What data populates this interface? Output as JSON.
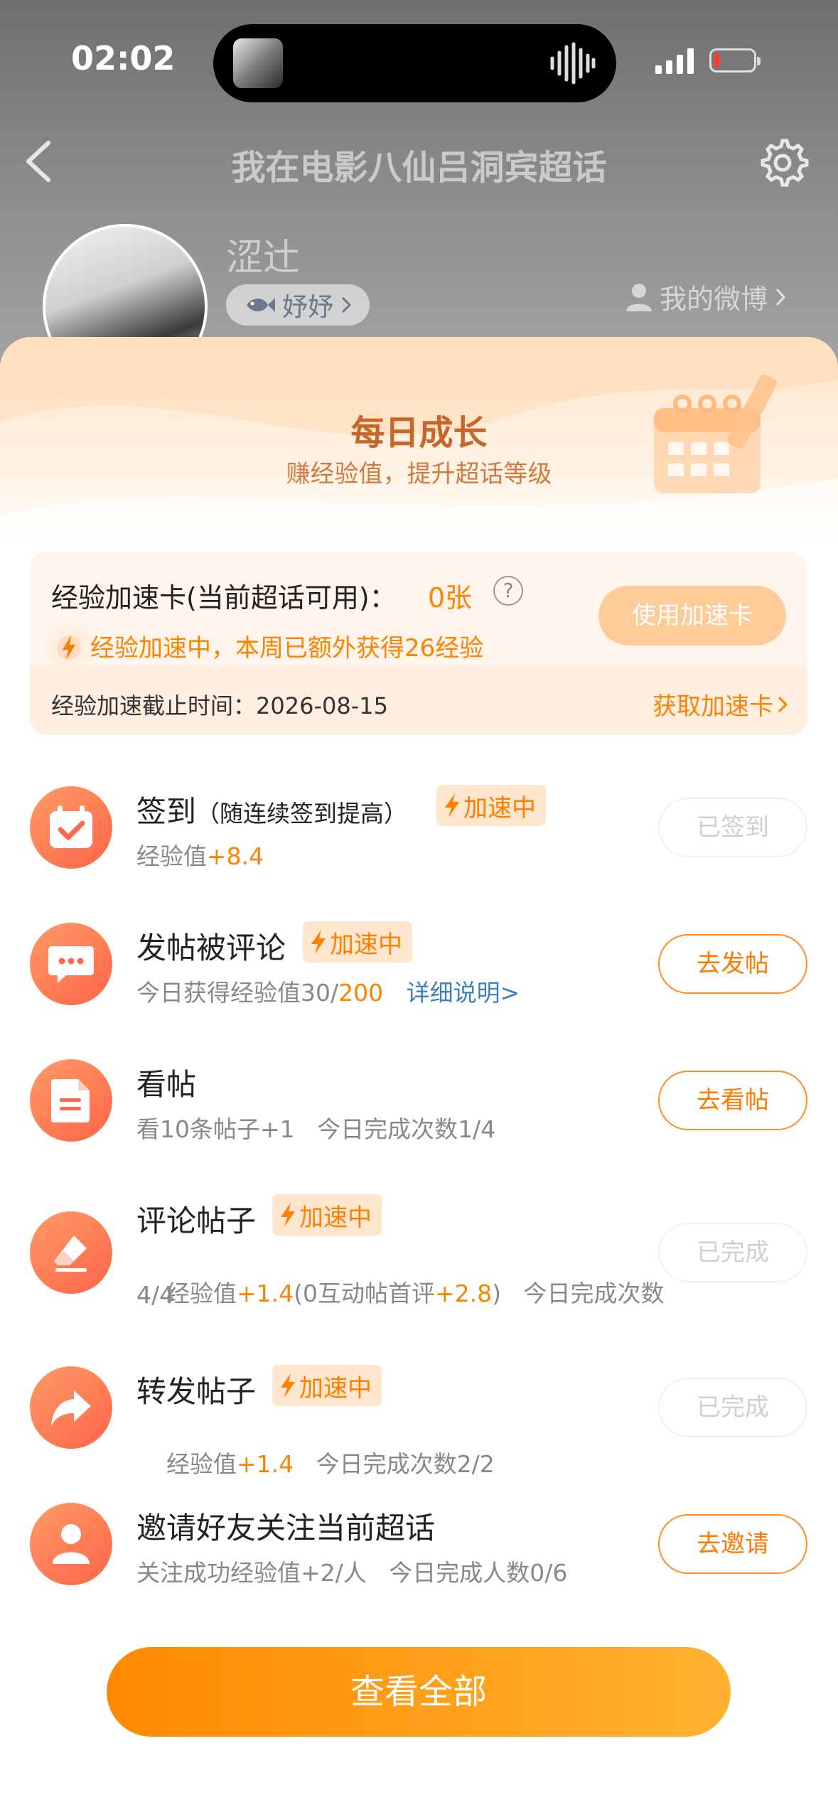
{
  "status_bar": {
    "time": "02:02"
  },
  "header": {
    "title": "我在电影八仙吕洞宾超话"
  },
  "profile": {
    "name": "涩辻",
    "level_label": "妤妤",
    "my_weibo": "我的微博"
  },
  "panel": {
    "title": "每日成长",
    "subtitle": "赚经验值，提升超话等级",
    "boost": {
      "label": "经验加速卡(当前超话可用)：",
      "count": "0张",
      "status": "经验加速中，本周已额外获得26经验",
      "use_button": "使用加速卡",
      "deadline": "经验加速截止时间：2026-08-15",
      "get_link": "获取加速卡"
    },
    "boost_tag": "加速中",
    "tasks": [
      {
        "icon": "calendar-check-icon",
        "title": "签到",
        "title_note": "（随连续签到提高）",
        "desc_prefix": "经验值",
        "desc_value": "+8.4",
        "button": "已签到",
        "button_state": "done"
      },
      {
        "icon": "chat-bubble-icon",
        "title": "发帖被评论",
        "desc_prefix": "今日获得经验值30/",
        "desc_value": "200",
        "desc_link": "详细说明>",
        "button": "去发帖",
        "button_state": "go"
      },
      {
        "icon": "document-icon",
        "title": "看帖",
        "desc_prefix": "看10条帖子+1   今日完成次数1/4",
        "button": "去看帖",
        "button_state": "go"
      },
      {
        "icon": "eraser-icon",
        "title": "评论帖子",
        "desc_prefix": "经验值",
        "desc_value": "+1.4",
        "desc_mid": "(0互动帖首评",
        "desc_value2": "+2.8",
        "desc_suffix": ")   今日完成次数",
        "desc_line2": "4/4",
        "button": "已完成",
        "button_state": "done"
      },
      {
        "icon": "share-arrow-icon",
        "title": "转发帖子",
        "desc_prefix": "经验值",
        "desc_value": "+1.4",
        "desc_suffix": "   今日完成次数2/2",
        "button": "已完成",
        "button_state": "done"
      },
      {
        "icon": "person-icon",
        "title": "邀请好友关注当前超话",
        "desc_prefix": "关注成功经验值+2/人   今日完成人数0/6",
        "button": "去邀请",
        "button_state": "go"
      }
    ],
    "view_all": "查看全部"
  },
  "colors": {
    "accent": "#ff8200",
    "icon_gradient_start": "#ff9a66",
    "icon_gradient_end": "#ff6548"
  }
}
